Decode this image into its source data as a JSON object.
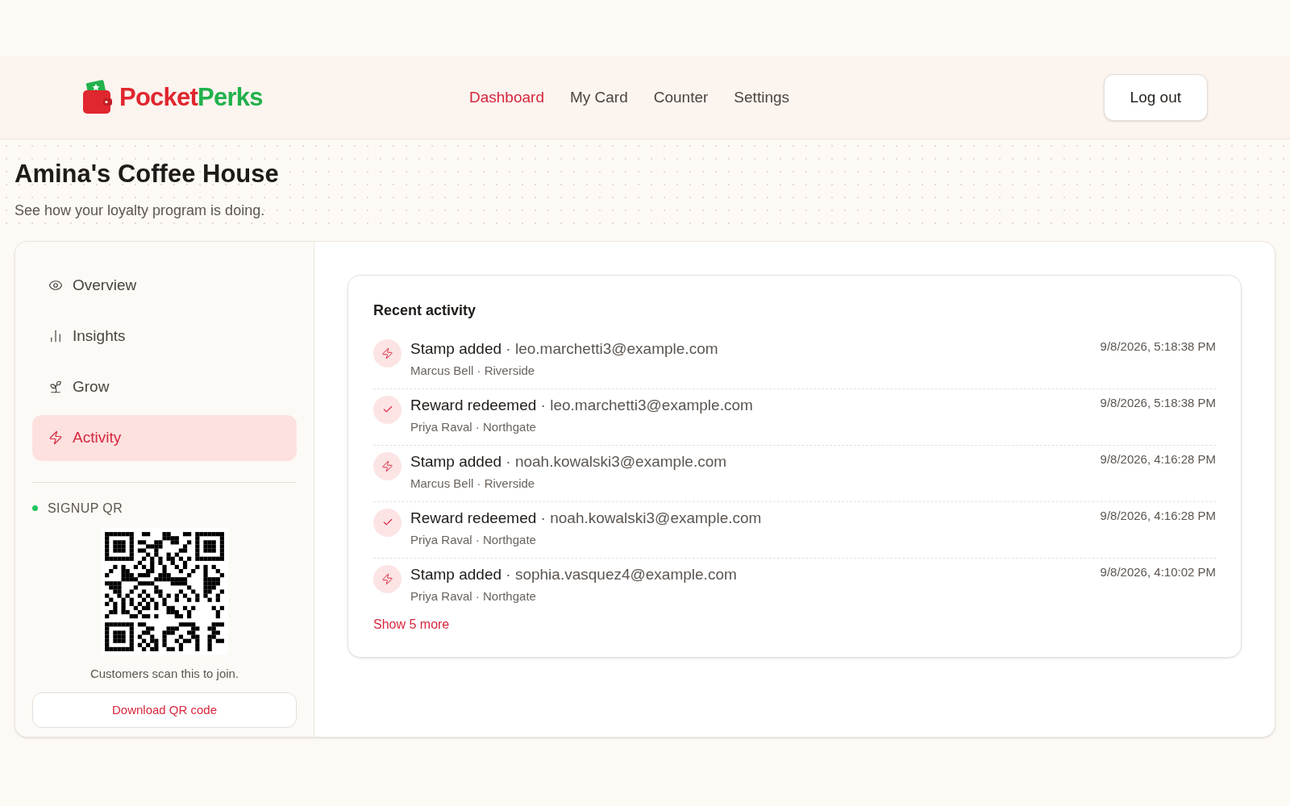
{
  "brand": {
    "part1": "Pocket",
    "part2": "Perks"
  },
  "nav": [
    {
      "label": "Dashboard",
      "selected": true
    },
    {
      "label": "My Card",
      "selected": false
    },
    {
      "label": "Counter",
      "selected": false
    },
    {
      "label": "Settings",
      "selected": false
    }
  ],
  "logout": "Log out",
  "page": {
    "title": "Amina's Coffee House",
    "subtitle": "See how your loyalty program is doing."
  },
  "sidebar": {
    "items": [
      {
        "label": "Overview",
        "selected": false
      },
      {
        "label": "Insights",
        "selected": false
      },
      {
        "label": "Grow",
        "selected": false
      },
      {
        "label": "Activity",
        "selected": true
      }
    ],
    "qr": {
      "heading": "SIGNUP QR",
      "caption": "Customers scan this to join.",
      "button": "Download QR code"
    }
  },
  "activity": {
    "title": "Recent activity",
    "separator": "·",
    "rows": [
      {
        "kind": "stamp",
        "action": "Stamp added",
        "email": "leo.marchetti3@example.com",
        "meta": "Marcus Bell · Riverside",
        "time": "9/8/2026, 5:18:38 PM"
      },
      {
        "kind": "reward",
        "action": "Reward redeemed",
        "email": "leo.marchetti3@example.com",
        "meta": "Priya Raval · Northgate",
        "time": "9/8/2026, 5:18:38 PM"
      },
      {
        "kind": "stamp",
        "action": "Stamp added",
        "email": "noah.kowalski3@example.com",
        "meta": "Marcus Bell · Riverside",
        "time": "9/8/2026, 4:16:28 PM"
      },
      {
        "kind": "reward",
        "action": "Reward redeemed",
        "email": "noah.kowalski3@example.com",
        "meta": "Priya Raval · Northgate",
        "time": "9/8/2026, 4:16:28 PM"
      },
      {
        "kind": "stamp",
        "action": "Stamp added",
        "email": "sophia.vasquez4@example.com",
        "meta": "Priya Raval · Northgate",
        "time": "9/8/2026, 4:10:02 PM"
      }
    ],
    "more": "Show 5 more"
  }
}
